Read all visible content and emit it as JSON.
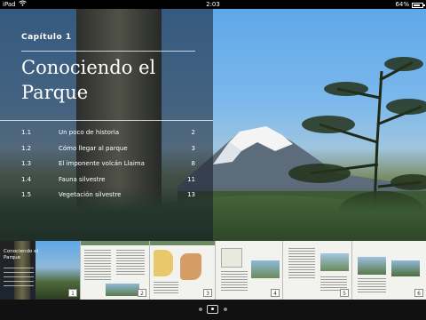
{
  "status_bar": {
    "device": "iPad",
    "time": "2:03",
    "battery": "64%",
    "battery_level": 0.64,
    "wifi_icon": "wifi-icon",
    "battery_icon": "battery-icon"
  },
  "chapter": {
    "label": "Capítulo 1",
    "title": "Conociendo el Parque",
    "toc": [
      {
        "num": "1.1",
        "text": "Un poco de historia",
        "page": "2"
      },
      {
        "num": "1.2",
        "text": "Cómo llegar al parque",
        "page": "3"
      },
      {
        "num": "1.3",
        "text": "El imponente volcán Llaima",
        "page": "8"
      },
      {
        "num": "1.4",
        "text": "Fauna silvestre",
        "page": "11"
      },
      {
        "num": "1.5",
        "text": "Vegetación silvestre",
        "page": "13"
      }
    ]
  },
  "thumbnails": {
    "first_title": "Conociendo el Parque",
    "pages": [
      "1",
      "2",
      "3",
      "4",
      "5",
      "6"
    ]
  },
  "pager": {
    "current_page_index": 2,
    "page_count": 3
  }
}
